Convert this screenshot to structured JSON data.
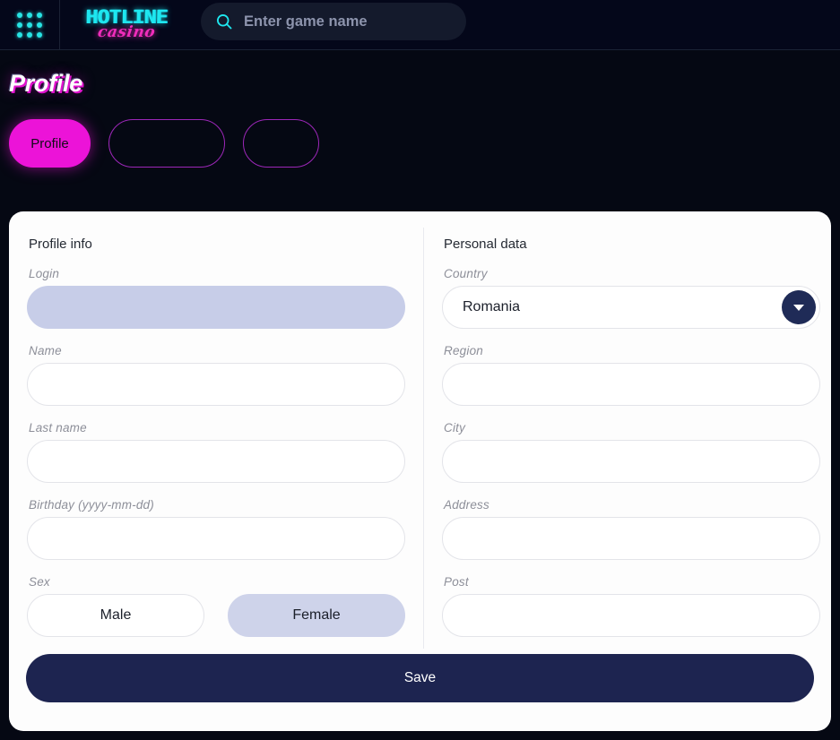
{
  "header": {
    "apps_icon": "apps-grid-icon",
    "logo": {
      "top": "HOTLINE",
      "bottom": "casino"
    },
    "search": {
      "icon": "search-icon",
      "placeholder": "Enter game name",
      "value": ""
    }
  },
  "page": {
    "title": "Profile"
  },
  "tabs": [
    {
      "label": "Profile",
      "active": true
    },
    {
      "label": "",
      "active": false
    },
    {
      "label": "",
      "active": false
    }
  ],
  "profile_info": {
    "section_title": "Profile info",
    "fields": [
      {
        "label": "Login",
        "value": "",
        "placeholder": "",
        "disabled": true
      },
      {
        "label": "Name",
        "value": "",
        "placeholder": "",
        "disabled": false
      },
      {
        "label": "Last name",
        "value": "",
        "placeholder": "",
        "disabled": false
      },
      {
        "label": "Birthday (yyyy-mm-dd)",
        "value": "",
        "placeholder": "",
        "disabled": false
      }
    ],
    "sex": {
      "label": "Sex",
      "options": [
        {
          "label": "Male",
          "selected": false
        },
        {
          "label": "Female",
          "selected": true
        }
      ]
    }
  },
  "personal_data": {
    "section_title": "Personal data",
    "country": {
      "label": "Country",
      "value": "Romania",
      "arrow_icon": "chevron-down-icon"
    },
    "fields": [
      {
        "label": "Region",
        "value": "",
        "placeholder": ""
      },
      {
        "label": "City",
        "value": "",
        "placeholder": ""
      },
      {
        "label": "Address",
        "value": "",
        "placeholder": ""
      },
      {
        "label": "Post",
        "value": "",
        "placeholder": ""
      }
    ]
  },
  "actions": {
    "save_label": "Save"
  },
  "colors": {
    "page_bg": "#050813",
    "header_bg": "#04071a",
    "accent_magenta": "#ec13d8",
    "accent_cyan": "#1ee8f0",
    "card_bg": "#fdfdfd",
    "disabled_field": "#c7cde8",
    "selected_toggle": "#ced3ea",
    "save_bg": "#1d2450"
  }
}
